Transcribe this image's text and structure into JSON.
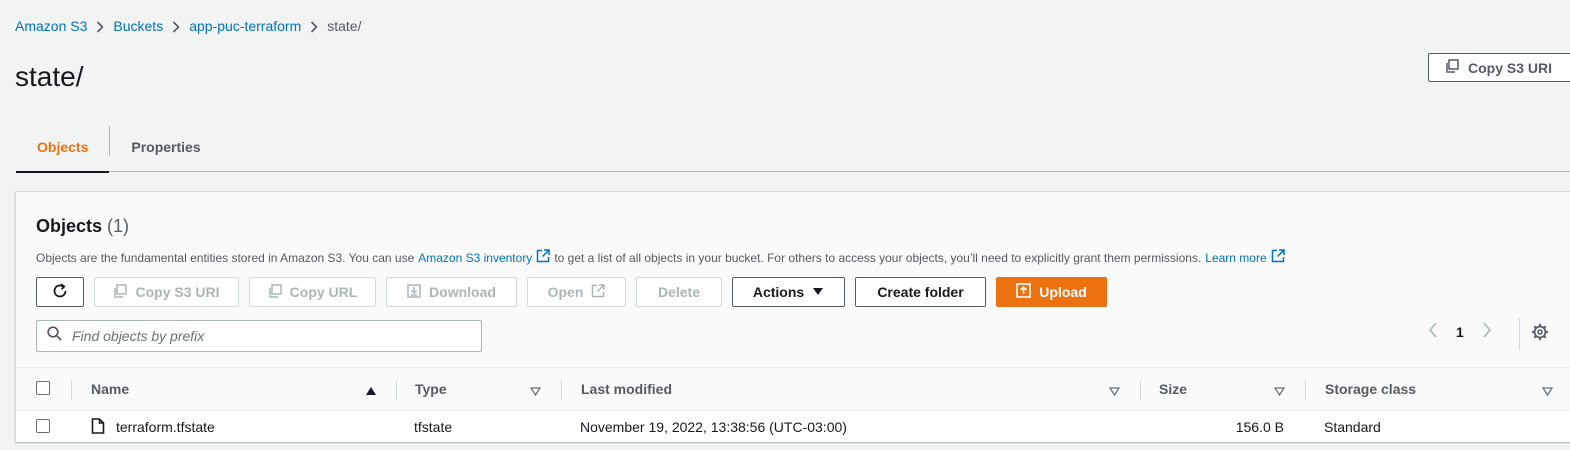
{
  "breadcrumb": [
    "Amazon S3",
    "Buckets",
    "app-puc-terraform",
    "state/"
  ],
  "page_title": "state/",
  "copy_uri_top": "Copy S3 URI",
  "tabs": [
    "Objects",
    "Properties"
  ],
  "panel": {
    "title": "Objects",
    "count": "(1)",
    "desc_part1": "Objects are the fundamental entities stored in Amazon S3. You can use",
    "desc_link1": "Amazon S3 inventory",
    "desc_part2": "to get a list of all objects in your bucket. For others to access your objects, you’ll need to explicitly grant them permissions.",
    "desc_link2": "Learn more"
  },
  "toolbar": {
    "copy_uri": "Copy S3 URI",
    "copy_url": "Copy URL",
    "download": "Download",
    "open": "Open",
    "delete": "Delete",
    "actions": "Actions",
    "create_folder": "Create folder",
    "upload": "Upload"
  },
  "search": {
    "placeholder": "Find objects by prefix",
    "value": ""
  },
  "pagination": {
    "page": "1"
  },
  "table": {
    "columns": [
      "Name",
      "Type",
      "Last modified",
      "Size",
      "Storage class"
    ],
    "rows": [
      {
        "name": "terraform.tfstate",
        "type": "tfstate",
        "last_modified": "November 19, 2022, 13:38:56 (UTC-03:00)",
        "size": "156.0 B",
        "storage_class": "Standard"
      }
    ]
  },
  "colors": {
    "accent": "#ec7211",
    "link": "#0073bb",
    "text": "#16191f",
    "muted": "#545b64"
  }
}
